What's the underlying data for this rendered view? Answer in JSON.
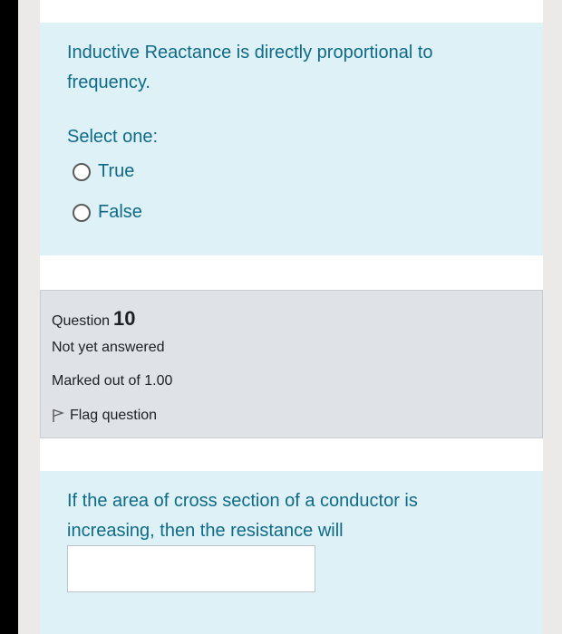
{
  "question9": {
    "text": "Inductive Reactance is directly proportional to frequency.",
    "prompt": "Select one:",
    "options": [
      {
        "label": "True",
        "selected": false
      },
      {
        "label": "False",
        "selected": false
      }
    ]
  },
  "question10": {
    "label": "Question",
    "number": "10",
    "state": "Not yet answered",
    "grade": "Marked out of 1.00",
    "flag_label": "Flag question",
    "text": "If the area of cross section of a conductor is increasing, then the resistance will",
    "answer_value": ""
  },
  "colors": {
    "question_bg": "#def1f7",
    "info_bg": "#dfe3e7",
    "question_text": "#0f6a88"
  }
}
